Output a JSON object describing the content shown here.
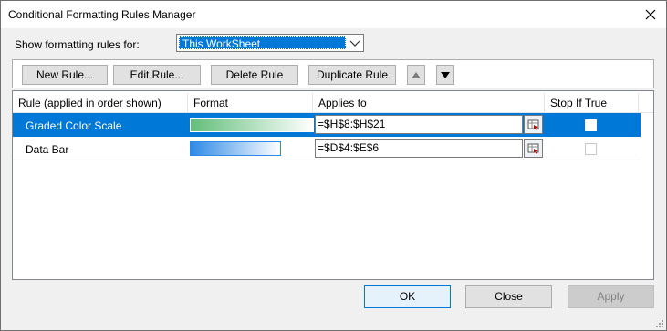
{
  "window": {
    "title": "Conditional Formatting Rules Manager"
  },
  "filter": {
    "label": "Show formatting rules for:",
    "value": "This WorkSheet"
  },
  "toolbar": {
    "new_rule": "New Rule...",
    "edit_rule": "Edit Rule...",
    "delete_rule": "Delete Rule",
    "duplicate_rule": "Duplicate Rule"
  },
  "table": {
    "headers": [
      "Rule (applied in order shown)",
      "Format",
      "Applies to",
      "Stop If True"
    ],
    "rows": [
      {
        "rule": "Graded Color Scale",
        "format": "color-scale",
        "applies_to": "=$H$8:$H$21",
        "stop_if_true": false,
        "selected": true
      },
      {
        "rule": "Data Bar",
        "format": "data-bar",
        "applies_to": "=$D$4:$E$6",
        "stop_if_true": false,
        "selected": false
      }
    ]
  },
  "footer": {
    "ok": "OK",
    "close": "Close",
    "apply": "Apply"
  },
  "colors": {
    "selection": "#0078d7",
    "scale_start": "#63be7b",
    "scale_end": "#ffffff",
    "databar": "#2e8ae6"
  }
}
